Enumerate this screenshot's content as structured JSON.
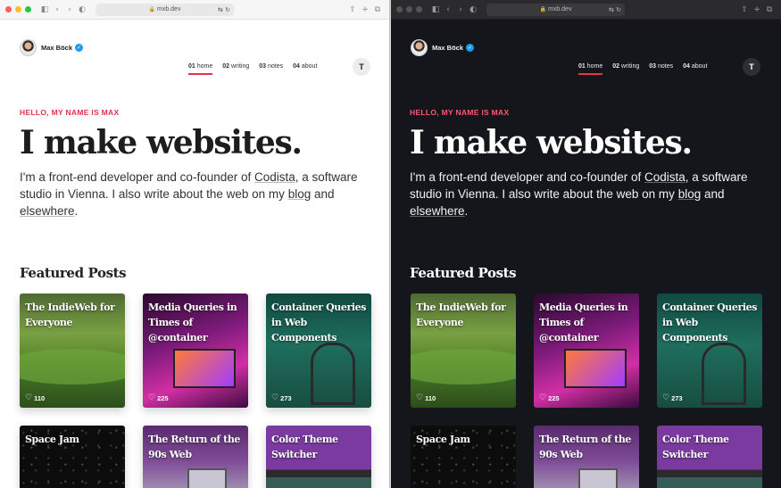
{
  "windows": [
    {
      "theme": "light",
      "chrome_buttons": [
        "◧",
        "‹",
        "›",
        "◐"
      ],
      "chrome_right": [
        "⇧",
        "+",
        "⧉"
      ]
    },
    {
      "theme": "dark",
      "chrome_buttons": [
        "◧",
        "‹",
        "›",
        "◐"
      ],
      "chrome_right": [
        "⇧",
        "+",
        "⧉"
      ]
    }
  ],
  "browser": {
    "url": "mxb.dev",
    "lock": "🔒",
    "tools": "⇆ ↻"
  },
  "site": {
    "name": "Max Böck",
    "verified_glyph": "✓",
    "theme_toggle_glyph": "T",
    "nav": [
      {
        "num": "01",
        "label": "home",
        "active": true
      },
      {
        "num": "02",
        "label": "writing",
        "active": false
      },
      {
        "num": "03",
        "label": "notes",
        "active": false
      },
      {
        "num": "04",
        "label": "about",
        "active": false
      }
    ]
  },
  "hero": {
    "eyebrow": "HELLO, MY NAME IS MAX",
    "headline": "I make websites.",
    "intro_1": "I'm a front-end developer and co-founder of ",
    "intro_link_1": "Codista",
    "intro_2": ", a software studio in Vienna. I also write about the web on my ",
    "intro_link_2": "blog",
    "intro_3": " and ",
    "intro_link_3": "elsewhere",
    "intro_4": "."
  },
  "featured": {
    "title": "Featured Posts",
    "posts": [
      {
        "title": "The IndieWeb for Everyone",
        "likes": "110",
        "bg": "green"
      },
      {
        "title": "Media Queries in Times of @container",
        "likes": "225",
        "bg": "magenta"
      },
      {
        "title": "Container Queries in Web Components",
        "likes": "273",
        "bg": "teal"
      },
      {
        "title": "Space Jam",
        "likes": "",
        "bg": "space"
      },
      {
        "title": "The Return of the 90s Web",
        "likes": "",
        "bg": "90s"
      },
      {
        "title": "Color Theme Switcher",
        "likes": "",
        "bg": "purple"
      }
    ]
  },
  "icons": {
    "heart": "♡"
  }
}
